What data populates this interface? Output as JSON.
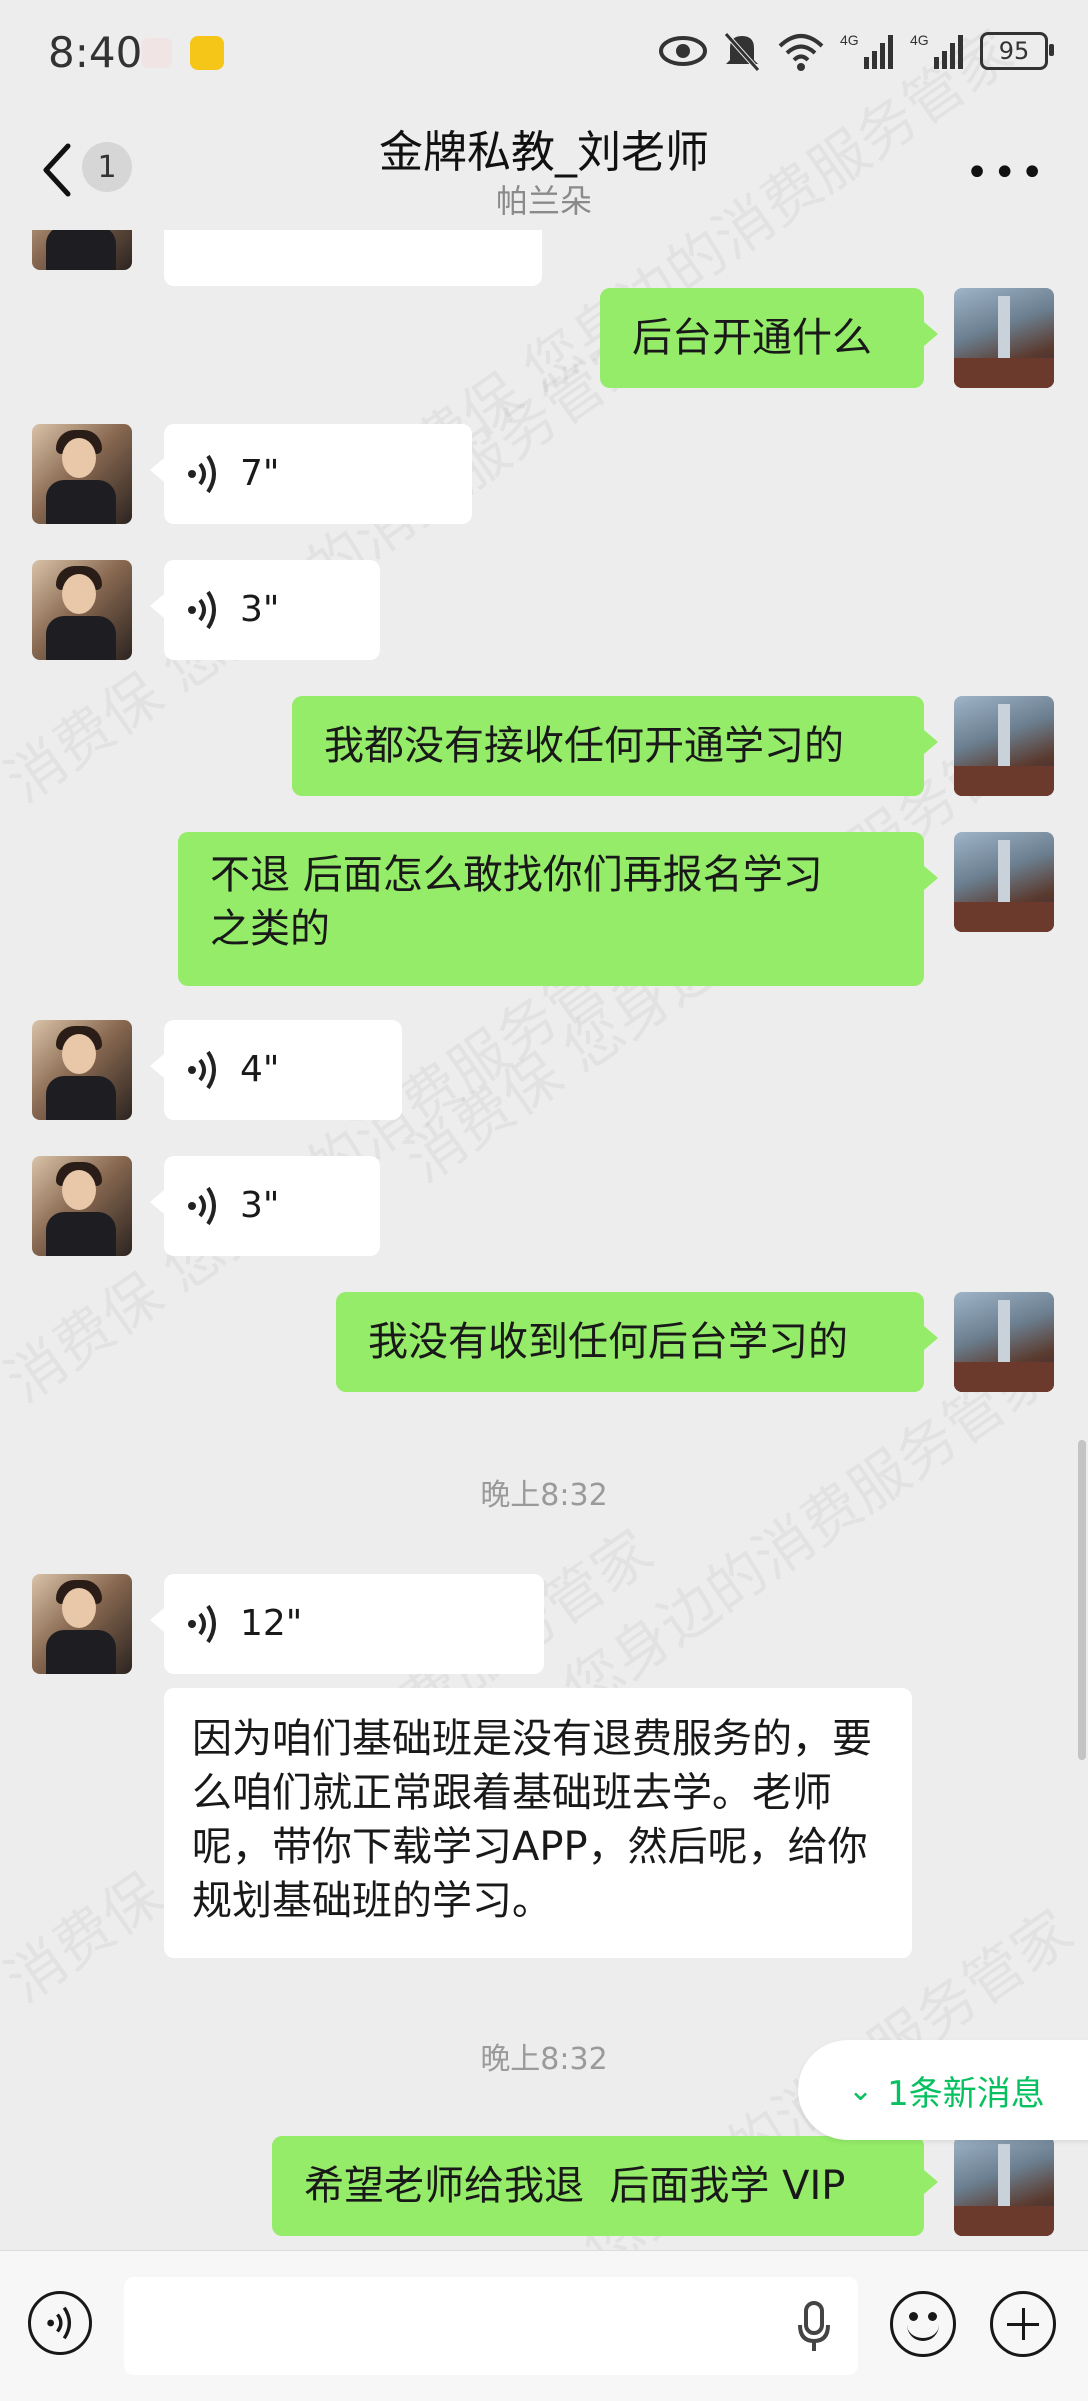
{
  "status_bar": {
    "time": "8:40",
    "battery": "95",
    "icons": [
      "huawei-icon",
      "app-icon",
      "eye-icon",
      "mute-icon",
      "wifi-icon",
      "4g-signal-icon",
      "4g-signal-icon",
      "battery-icon"
    ]
  },
  "header": {
    "back_icon": "chevron-left-icon",
    "unread_count": "1",
    "title": "金牌私教_刘老师",
    "subtitle": "帕兰朵",
    "more_icon": "more-icon"
  },
  "messages": [
    {
      "side": "right",
      "type": "text",
      "text": "后台开通什么"
    },
    {
      "side": "left",
      "type": "voice",
      "duration": "7\""
    },
    {
      "side": "left",
      "type": "voice",
      "duration": "3\""
    },
    {
      "side": "right",
      "type": "text",
      "text": "我都没有接收任何开通学习的"
    },
    {
      "side": "right",
      "type": "text",
      "text": "不退 后面怎么敢找你们再报名学习之类的"
    },
    {
      "side": "left",
      "type": "voice",
      "duration": "4\""
    },
    {
      "side": "left",
      "type": "voice",
      "duration": "3\""
    },
    {
      "side": "right",
      "type": "text",
      "text": "我没有收到任何后台学习的"
    },
    {
      "type": "time",
      "text": "晚上8:32"
    },
    {
      "side": "left",
      "type": "voice",
      "duration": "12\""
    },
    {
      "side": "left",
      "type": "text",
      "text": "因为咱们基础班是没有退费服务的，要么咱们就正常跟着基础班去学。老师呢，带你下载学习APP，然后呢，给你规划基础班的学习。"
    },
    {
      "type": "time",
      "text": "晚上8:32"
    },
    {
      "side": "right",
      "type": "text",
      "text": "希望老师给我退  后面我学 VIP"
    }
  ],
  "new_message_pill": {
    "icon": "double-chevron-down-icon",
    "label": "1条新消息"
  },
  "input_bar": {
    "voice_icon": "voice-mode-icon",
    "mic_icon": "mic-icon",
    "emoji_icon": "emoji-icon",
    "plus_icon": "plus-icon"
  },
  "watermark": "消费保 您身边的消费服务管家",
  "colors": {
    "background": "#ededed",
    "sent_bubble": "#95ec69",
    "received_bubble": "#ffffff",
    "accent": "#07c160"
  }
}
